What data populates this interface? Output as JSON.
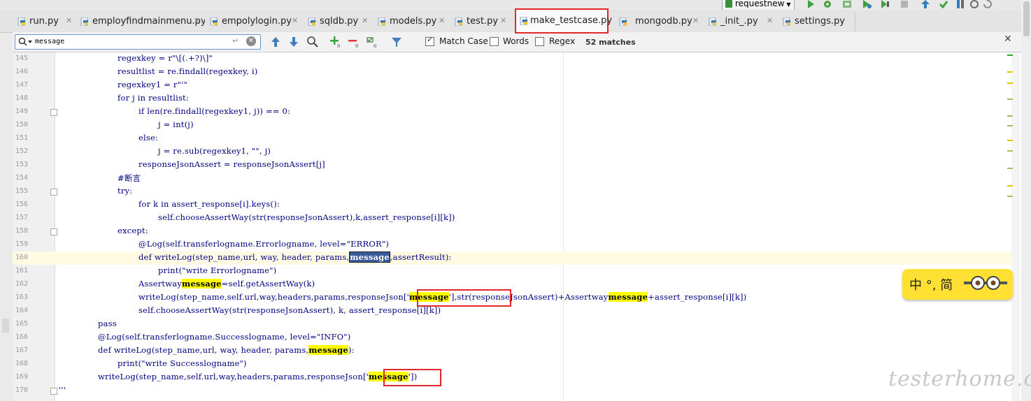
{
  "toolbar": {
    "run_config_label": "requestnew"
  },
  "tabs": [
    {
      "label": "run.py",
      "active": false
    },
    {
      "label": "employfindmainmenu.py",
      "active": false
    },
    {
      "label": "empolylogin.py",
      "active": false
    },
    {
      "label": "sqldb.py",
      "active": false
    },
    {
      "label": "models.py",
      "active": false
    },
    {
      "label": "test.py",
      "active": false
    },
    {
      "label": "make_testcase.py",
      "active": true
    },
    {
      "label": "mongodb.py",
      "active": false
    },
    {
      "label": "_init_.py",
      "active": false
    },
    {
      "label": "settings.py",
      "active": false
    }
  ],
  "search": {
    "query": "message",
    "match_case_label": "Match Case",
    "match_case_checked": true,
    "words_label": "Words",
    "words_checked": false,
    "regex_label": "Regex",
    "regex_checked": false,
    "matches_label": "52 matches"
  },
  "colors": {
    "highlight": "#ffff00",
    "selection": "#3b5a9e",
    "annotation_box": "#e0282a",
    "current_line": "#fffae3"
  },
  "editor": {
    "current_line": "160",
    "lines": [
      {
        "num": "145",
        "segs": [
          [
            "regexkey = r\"\\[(.+?)\\]\"",
            "plain"
          ]
        ]
      },
      {
        "num": "146",
        "segs": [
          [
            "resultlist = re.findall(regexkey, i)",
            "plain"
          ]
        ]
      },
      {
        "num": "147",
        "segs": [
          [
            "regexkey1 = r\"'\"",
            "plain"
          ]
        ]
      },
      {
        "num": "148",
        "segs": [
          [
            "for j in resultlist:",
            "plain"
          ]
        ]
      },
      {
        "num": "149",
        "segs": [
          [
            "if len(re.findall(regexkey1, j)) == 0:",
            "plain"
          ]
        ]
      },
      {
        "num": "150",
        "segs": [
          [
            "j = int(j)",
            "plain"
          ]
        ]
      },
      {
        "num": "151",
        "segs": [
          [
            "else:",
            "plain"
          ]
        ]
      },
      {
        "num": "152",
        "segs": [
          [
            "j = re.sub(regexkey1, \"\", j)",
            "plain"
          ]
        ]
      },
      {
        "num": "153",
        "segs": [
          [
            "responseJsonAssert = responseJsonAssert[j]",
            "plain"
          ]
        ]
      },
      {
        "num": "154",
        "segs": [
          [
            "#断言",
            "plain"
          ]
        ]
      },
      {
        "num": "155",
        "segs": [
          [
            "try:",
            "plain"
          ]
        ]
      },
      {
        "num": "156",
        "segs": [
          [
            "for k in assert_response[i].keys():",
            "plain"
          ]
        ]
      },
      {
        "num": "157",
        "segs": [
          [
            "self.chooseAssertWay(str(responseJsonAssert),k,assert_response[i][k])",
            "plain"
          ]
        ]
      },
      {
        "num": "158",
        "segs": [
          [
            "except:",
            "plain"
          ]
        ]
      },
      {
        "num": "159",
        "segs": [
          [
            "@Log(self.transferlogname.Errorlogname, level=\"ERROR\")",
            "plain"
          ]
        ]
      },
      {
        "num": "160",
        "segs": [
          [
            "def writeLog(step_name,url, way, header, params,",
            "plain"
          ],
          [
            "message",
            "sel"
          ],
          [
            ",assertResult):",
            "plain"
          ]
        ]
      },
      {
        "num": "161",
        "segs": [
          [
            "print(\"write Errorlogname\")",
            "plain"
          ]
        ]
      },
      {
        "num": "162",
        "segs": [
          [
            "Assertway",
            "plain"
          ],
          [
            "message",
            "hl"
          ],
          [
            "=self.getAssertWay(k)",
            "plain"
          ]
        ]
      },
      {
        "num": "163",
        "segs": [
          [
            "writeLog(step_name,self.url,way,headers,params,responseJson['",
            "plain"
          ],
          [
            "message",
            "hl"
          ],
          [
            "'],str(responseJsonAssert)+Assertway",
            "plain"
          ],
          [
            "message",
            "hl"
          ],
          [
            "+assert_response[i][k])",
            "plain"
          ]
        ]
      },
      {
        "num": "164",
        "segs": [
          [
            "self.chooseAssertWay(str(responseJsonAssert), k, assert_response[i][k])",
            "plain"
          ]
        ]
      },
      {
        "num": "165",
        "segs": [
          [
            "pass",
            "plain"
          ]
        ]
      },
      {
        "num": "166",
        "segs": [
          [
            "@Log(self.transferlogname.Successlogname, level=\"INFO\")",
            "plain"
          ]
        ]
      },
      {
        "num": "167",
        "segs": [
          [
            "def writeLog(step_name,url, way, header, params,",
            "plain"
          ],
          [
            "message",
            "hl"
          ],
          [
            "):",
            "plain"
          ]
        ]
      },
      {
        "num": "168",
        "segs": [
          [
            "print(\"write Successlogname\")",
            "plain"
          ]
        ]
      },
      {
        "num": "169",
        "segs": [
          [
            "writeLog(step_name,self.url,way,headers,params,responseJson['",
            "plain"
          ],
          [
            "message",
            "hl"
          ],
          [
            "'])",
            "plain"
          ]
        ]
      },
      {
        "num": "170",
        "segs": [
          [
            "'''",
            "plain"
          ]
        ]
      }
    ]
  },
  "ime": {
    "text": "中 °, 简"
  },
  "watermark": {
    "text": "testerhome.com"
  }
}
